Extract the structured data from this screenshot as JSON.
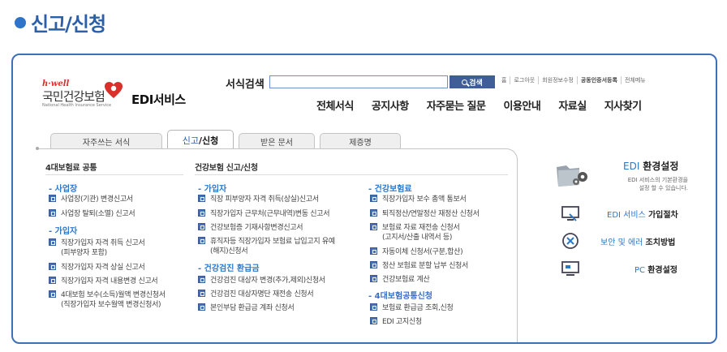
{
  "heading": "신고/신청",
  "logo": {
    "hwell": "h·well",
    "korean": "국민건강보험",
    "english": "National Health Insurance Service",
    "service": "EDI서비스"
  },
  "search": {
    "label": "서식검색",
    "value": "",
    "button": "검색"
  },
  "util_links": [
    "홈",
    "로그아웃",
    "회원정보수정",
    "공동인증서등록",
    "전체메뉴"
  ],
  "gnb": [
    "전체서식",
    "공지사항",
    "자주묻는 질문",
    "이용안내",
    "자료실",
    "지사찾기"
  ],
  "tabs": {
    "t1": "자주쓰는 서식",
    "t2_prefix": "신고",
    "t2_suffix": "/신청",
    "t3": "받은 문서",
    "t4": "제증명"
  },
  "col1": {
    "header": "4대보험료 공통",
    "sec1": "- 사업장",
    "i1": "사업장(기관) 변경신고서",
    "i2": "사업장 탈퇴(소멸) 신고서",
    "sec2": "- 가입자",
    "i3a": "직장가입자 자격 취득 신고서",
    "i3b": "(피부양자 포함)",
    "i4": "직장가입자 자격 상실 신고서",
    "i5": "직장가입자 자격 내용변경 신고서",
    "i6a": "4대보험 보수(소득)월액 변경신청서",
    "i6b": "(직장가입자 보수월액 변경신청서)"
  },
  "col2": {
    "header": "건강보험 신고/신청",
    "sec1": "- 가입자",
    "i1": "직장 피부양자 자격 취득(상실)신고서",
    "i2": "직장가입자 근무처(근무내역)변동 신고서",
    "i3": "건강보험증 기재사항변경신고서",
    "i4a": "휴직자등 직장가입자 보험료 납입고지 유예",
    "i4b": "(해지)신청서",
    "sec2": "- 건강검진 환급금",
    "i5": "건강검진 대상자 변경(추가,제외)신청서",
    "i6": "건강검진 대상자명단 재전송 신청서",
    "i7": "본인부담 환급금 계좌 신청서"
  },
  "col3": {
    "sec1": "- 건강보험료",
    "i1": "직장가입자 보수 총액 통보서",
    "i2": "퇴직정산/연말정산 재정산 신청서",
    "i3a": "보험료 자료 재전송 신청서",
    "i3b": "(고지서/산출 내역서 등)",
    "i4": "자동이체 신청서(구분,합산)",
    "i5": "정산 보험료 분할 납부 신청서",
    "i6": "건강보험료 계산",
    "sec2": "- 4대보험공통신청",
    "i7": "보험료 환급금 조회,신청",
    "i8": "EDI 고지신청"
  },
  "right": {
    "env_prefix": "EDI",
    "env_bold": "환경설정",
    "env_desc1": "EDI 서비스의 기본환경을",
    "env_desc2": "설정 할 수 있습니다.",
    "join_prefix": "EDI 서비스",
    "join_bold": "가입절차",
    "err_prefix": "보안 및 에러",
    "err_bold": "조치방법",
    "pc_prefix": "PC",
    "pc_bold": "환경설정"
  },
  "colors": {
    "accent": "#2b78c9",
    "frame": "#3f6fb5",
    "search_button": "#3f5d96",
    "heart": "#d9302c"
  }
}
